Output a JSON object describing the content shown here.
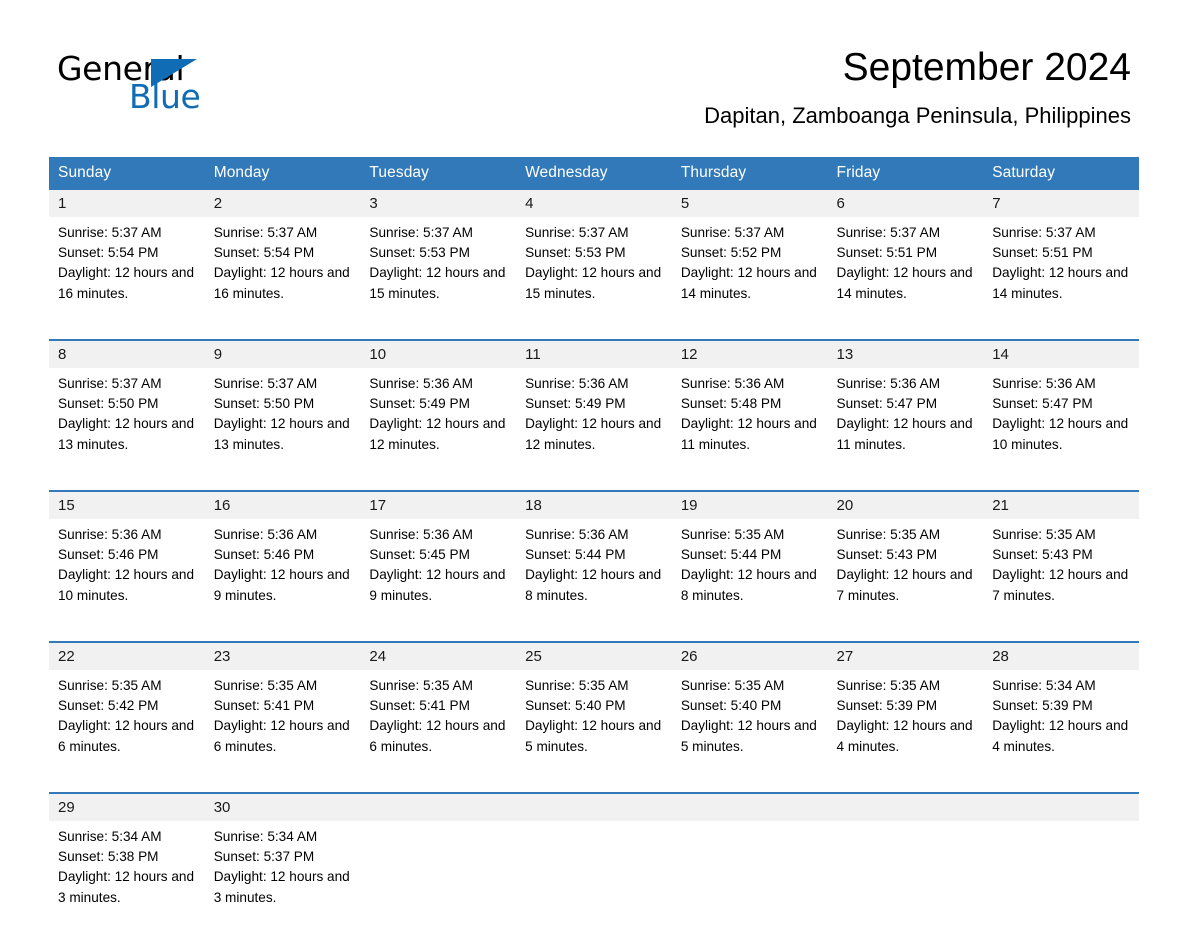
{
  "logo": {
    "word_general": "General",
    "word_blue": "Blue",
    "triangle_color": "#0f6cb5"
  },
  "header": {
    "month_title": "September 2024",
    "location": "Dapitan, Zamboanga Peninsula, Philippines"
  },
  "theme": {
    "header_blue": "#3179b8",
    "daynum_band": "#f1f1f1",
    "text": "#000000"
  },
  "calendar": {
    "weekday_headers": [
      "Sunday",
      "Monday",
      "Tuesday",
      "Wednesday",
      "Thursday",
      "Friday",
      "Saturday"
    ],
    "weeks": [
      [
        {
          "day": "1",
          "sunrise": "Sunrise: 5:37 AM",
          "sunset": "Sunset: 5:54 PM",
          "daylight": "Daylight: 12 hours and 16 minutes."
        },
        {
          "day": "2",
          "sunrise": "Sunrise: 5:37 AM",
          "sunset": "Sunset: 5:54 PM",
          "daylight": "Daylight: 12 hours and 16 minutes."
        },
        {
          "day": "3",
          "sunrise": "Sunrise: 5:37 AM",
          "sunset": "Sunset: 5:53 PM",
          "daylight": "Daylight: 12 hours and 15 minutes."
        },
        {
          "day": "4",
          "sunrise": "Sunrise: 5:37 AM",
          "sunset": "Sunset: 5:53 PM",
          "daylight": "Daylight: 12 hours and 15 minutes."
        },
        {
          "day": "5",
          "sunrise": "Sunrise: 5:37 AM",
          "sunset": "Sunset: 5:52 PM",
          "daylight": "Daylight: 12 hours and 14 minutes."
        },
        {
          "day": "6",
          "sunrise": "Sunrise: 5:37 AM",
          "sunset": "Sunset: 5:51 PM",
          "daylight": "Daylight: 12 hours and 14 minutes."
        },
        {
          "day": "7",
          "sunrise": "Sunrise: 5:37 AM",
          "sunset": "Sunset: 5:51 PM",
          "daylight": "Daylight: 12 hours and 14 minutes."
        }
      ],
      [
        {
          "day": "8",
          "sunrise": "Sunrise: 5:37 AM",
          "sunset": "Sunset: 5:50 PM",
          "daylight": "Daylight: 12 hours and 13 minutes."
        },
        {
          "day": "9",
          "sunrise": "Sunrise: 5:37 AM",
          "sunset": "Sunset: 5:50 PM",
          "daylight": "Daylight: 12 hours and 13 minutes."
        },
        {
          "day": "10",
          "sunrise": "Sunrise: 5:36 AM",
          "sunset": "Sunset: 5:49 PM",
          "daylight": "Daylight: 12 hours and 12 minutes."
        },
        {
          "day": "11",
          "sunrise": "Sunrise: 5:36 AM",
          "sunset": "Sunset: 5:49 PM",
          "daylight": "Daylight: 12 hours and 12 minutes."
        },
        {
          "day": "12",
          "sunrise": "Sunrise: 5:36 AM",
          "sunset": "Sunset: 5:48 PM",
          "daylight": "Daylight: 12 hours and 11 minutes."
        },
        {
          "day": "13",
          "sunrise": "Sunrise: 5:36 AM",
          "sunset": "Sunset: 5:47 PM",
          "daylight": "Daylight: 12 hours and 11 minutes."
        },
        {
          "day": "14",
          "sunrise": "Sunrise: 5:36 AM",
          "sunset": "Sunset: 5:47 PM",
          "daylight": "Daylight: 12 hours and 10 minutes."
        }
      ],
      [
        {
          "day": "15",
          "sunrise": "Sunrise: 5:36 AM",
          "sunset": "Sunset: 5:46 PM",
          "daylight": "Daylight: 12 hours and 10 minutes."
        },
        {
          "day": "16",
          "sunrise": "Sunrise: 5:36 AM",
          "sunset": "Sunset: 5:46 PM",
          "daylight": "Daylight: 12 hours and 9 minutes."
        },
        {
          "day": "17",
          "sunrise": "Sunrise: 5:36 AM",
          "sunset": "Sunset: 5:45 PM",
          "daylight": "Daylight: 12 hours and 9 minutes."
        },
        {
          "day": "18",
          "sunrise": "Sunrise: 5:36 AM",
          "sunset": "Sunset: 5:44 PM",
          "daylight": "Daylight: 12 hours and 8 minutes."
        },
        {
          "day": "19",
          "sunrise": "Sunrise: 5:35 AM",
          "sunset": "Sunset: 5:44 PM",
          "daylight": "Daylight: 12 hours and 8 minutes."
        },
        {
          "day": "20",
          "sunrise": "Sunrise: 5:35 AM",
          "sunset": "Sunset: 5:43 PM",
          "daylight": "Daylight: 12 hours and 7 minutes."
        },
        {
          "day": "21",
          "sunrise": "Sunrise: 5:35 AM",
          "sunset": "Sunset: 5:43 PM",
          "daylight": "Daylight: 12 hours and 7 minutes."
        }
      ],
      [
        {
          "day": "22",
          "sunrise": "Sunrise: 5:35 AM",
          "sunset": "Sunset: 5:42 PM",
          "daylight": "Daylight: 12 hours and 6 minutes."
        },
        {
          "day": "23",
          "sunrise": "Sunrise: 5:35 AM",
          "sunset": "Sunset: 5:41 PM",
          "daylight": "Daylight: 12 hours and 6 minutes."
        },
        {
          "day": "24",
          "sunrise": "Sunrise: 5:35 AM",
          "sunset": "Sunset: 5:41 PM",
          "daylight": "Daylight: 12 hours and 6 minutes."
        },
        {
          "day": "25",
          "sunrise": "Sunrise: 5:35 AM",
          "sunset": "Sunset: 5:40 PM",
          "daylight": "Daylight: 12 hours and 5 minutes."
        },
        {
          "day": "26",
          "sunrise": "Sunrise: 5:35 AM",
          "sunset": "Sunset: 5:40 PM",
          "daylight": "Daylight: 12 hours and 5 minutes."
        },
        {
          "day": "27",
          "sunrise": "Sunrise: 5:35 AM",
          "sunset": "Sunset: 5:39 PM",
          "daylight": "Daylight: 12 hours and 4 minutes."
        },
        {
          "day": "28",
          "sunrise": "Sunrise: 5:34 AM",
          "sunset": "Sunset: 5:39 PM",
          "daylight": "Daylight: 12 hours and 4 minutes."
        }
      ],
      [
        {
          "day": "29",
          "sunrise": "Sunrise: 5:34 AM",
          "sunset": "Sunset: 5:38 PM",
          "daylight": "Daylight: 12 hours and 3 minutes."
        },
        {
          "day": "30",
          "sunrise": "Sunrise: 5:34 AM",
          "sunset": "Sunset: 5:37 PM",
          "daylight": "Daylight: 12 hours and 3 minutes."
        },
        {
          "day": "",
          "sunrise": "",
          "sunset": "",
          "daylight": ""
        },
        {
          "day": "",
          "sunrise": "",
          "sunset": "",
          "daylight": ""
        },
        {
          "day": "",
          "sunrise": "",
          "sunset": "",
          "daylight": ""
        },
        {
          "day": "",
          "sunrise": "",
          "sunset": "",
          "daylight": ""
        },
        {
          "day": "",
          "sunrise": "",
          "sunset": "",
          "daylight": ""
        }
      ]
    ]
  }
}
